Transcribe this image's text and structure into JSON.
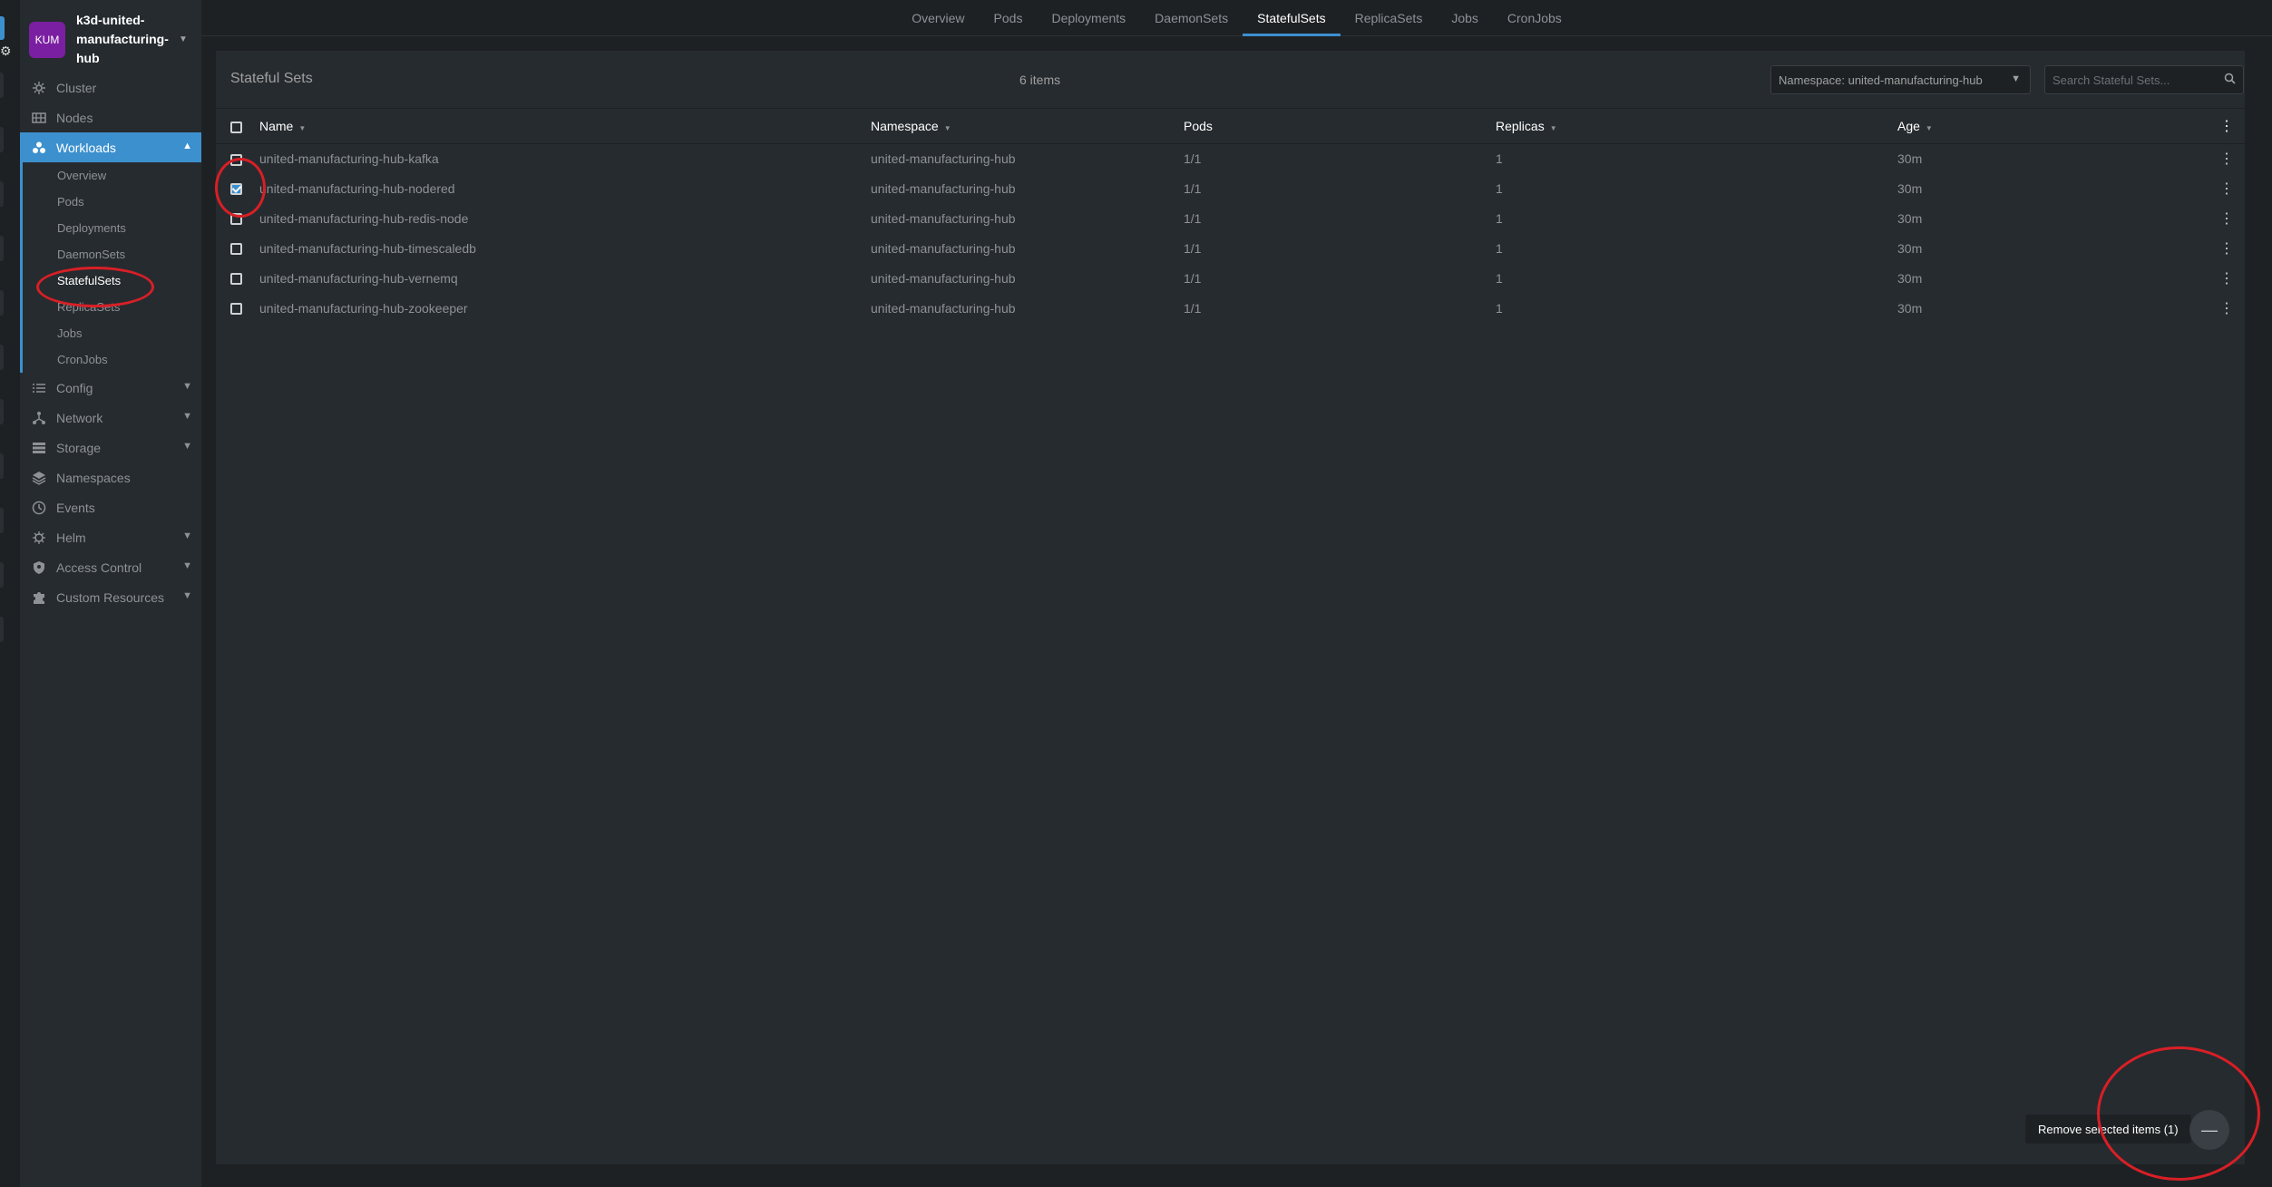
{
  "cluster": {
    "initials": "KUM",
    "name": "k3d-united-manufacturing-hub"
  },
  "sidebar": {
    "items": [
      {
        "label": "Cluster",
        "icon": "cluster-icon"
      },
      {
        "label": "Nodes",
        "icon": "nodes-icon"
      },
      {
        "label": "Workloads",
        "icon": "workloads-icon",
        "expanded": true
      },
      {
        "label": "Config",
        "icon": "config-icon"
      },
      {
        "label": "Network",
        "icon": "network-icon"
      },
      {
        "label": "Storage",
        "icon": "storage-icon"
      },
      {
        "label": "Namespaces",
        "icon": "namespaces-icon"
      },
      {
        "label": "Events",
        "icon": "events-icon"
      },
      {
        "label": "Helm",
        "icon": "helm-icon"
      },
      {
        "label": "Access Control",
        "icon": "access-control-icon"
      },
      {
        "label": "Custom Resources",
        "icon": "custom-resources-icon"
      }
    ],
    "workloads_sub": [
      "Overview",
      "Pods",
      "Deployments",
      "DaemonSets",
      "StatefulSets",
      "ReplicaSets",
      "Jobs",
      "CronJobs"
    ]
  },
  "tabs": [
    "Overview",
    "Pods",
    "Deployments",
    "DaemonSets",
    "StatefulSets",
    "ReplicaSets",
    "Jobs",
    "CronJobs"
  ],
  "panel": {
    "title": "Stateful Sets",
    "count": "6 items",
    "namespace_select": "Namespace: united-manufacturing-hub",
    "search_placeholder": "Search Stateful Sets..."
  },
  "table": {
    "headers": {
      "name": "Name",
      "namespace": "Namespace",
      "pods": "Pods",
      "replicas": "Replicas",
      "age": "Age"
    },
    "rows": [
      {
        "name": "united-manufacturing-hub-kafka",
        "namespace": "united-manufacturing-hub",
        "pods": "1/1",
        "replicas": "1",
        "age": "30m",
        "checked": false
      },
      {
        "name": "united-manufacturing-hub-nodered",
        "namespace": "united-manufacturing-hub",
        "pods": "1/1",
        "replicas": "1",
        "age": "30m",
        "checked": true
      },
      {
        "name": "united-manufacturing-hub-redis-node",
        "namespace": "united-manufacturing-hub",
        "pods": "1/1",
        "replicas": "1",
        "age": "30m",
        "checked": false
      },
      {
        "name": "united-manufacturing-hub-timescaledb",
        "namespace": "united-manufacturing-hub",
        "pods": "1/1",
        "replicas": "1",
        "age": "30m",
        "checked": false
      },
      {
        "name": "united-manufacturing-hub-vernemq",
        "namespace": "united-manufacturing-hub",
        "pods": "1/1",
        "replicas": "1",
        "age": "30m",
        "checked": false
      },
      {
        "name": "united-manufacturing-hub-zookeeper",
        "namespace": "united-manufacturing-hub",
        "pods": "1/1",
        "replicas": "1",
        "age": "30m",
        "checked": false
      }
    ]
  },
  "actions": {
    "remove_label": "Remove selected items (1)"
  },
  "colors": {
    "accent": "#3d90ce",
    "annotation": "#d81f26",
    "avatar": "#7b1fa2"
  }
}
